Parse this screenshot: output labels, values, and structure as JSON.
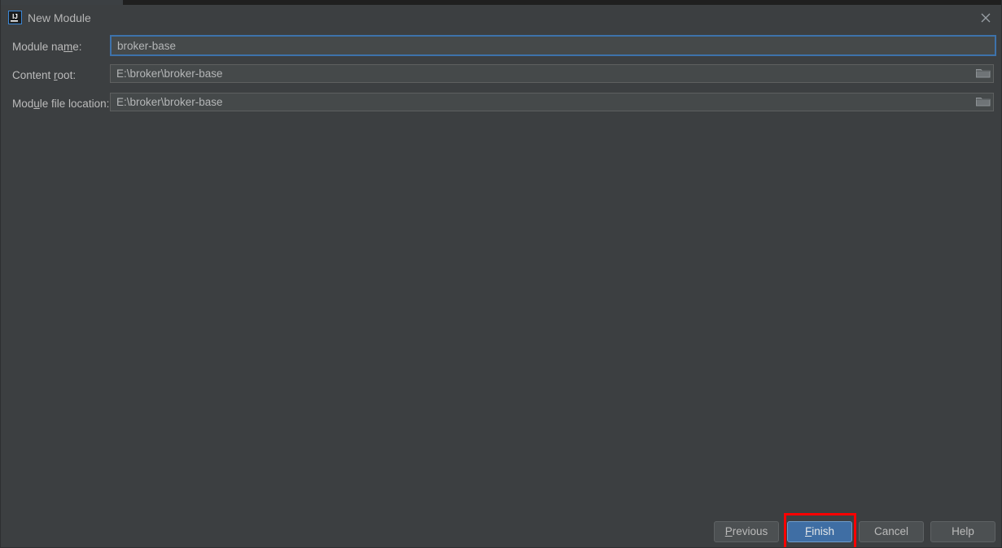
{
  "window": {
    "title": "New Module",
    "app_icon": "intellij-idea-icon",
    "close_icon": "close-icon",
    "background_color": "#3c3f41"
  },
  "form": {
    "fields": [
      {
        "label_before": "Module na",
        "label_mnemonic": "m",
        "label_after": "e:",
        "value": "broker-base",
        "focused": true,
        "has_browse": false
      },
      {
        "label_before": "Content ",
        "label_mnemonic": "r",
        "label_after": "oot:",
        "value": "E:\\broker\\broker-base",
        "focused": false,
        "has_browse": true,
        "browse_icon": "folder-icon"
      },
      {
        "label_before": "Mod",
        "label_mnemonic": "u",
        "label_after": "le file location:",
        "value": "E:\\broker\\broker-base",
        "focused": false,
        "has_browse": true,
        "browse_icon": "folder-icon"
      }
    ]
  },
  "footer": {
    "buttons": [
      {
        "before": "",
        "mnemonic": "P",
        "after": "revious",
        "default": false,
        "highlighted": false
      },
      {
        "before": "",
        "mnemonic": "F",
        "after": "inish",
        "default": true,
        "highlighted": true
      },
      {
        "before": "Cancel",
        "mnemonic": "",
        "after": "",
        "default": false,
        "highlighted": false
      },
      {
        "before": "Help",
        "mnemonic": "",
        "after": "",
        "default": false,
        "highlighted": false
      }
    ],
    "highlight_color": "#fe0000"
  }
}
